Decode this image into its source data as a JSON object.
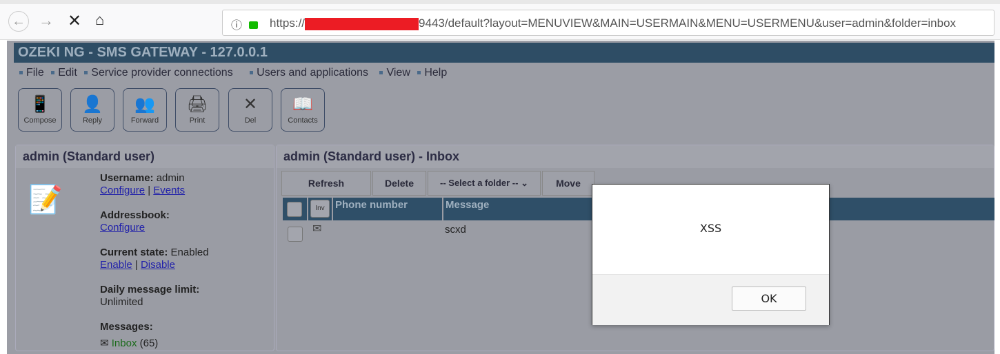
{
  "browser": {
    "url_prefix": "https://",
    "url_suffix": "9443/default?layout=MENUVIEW&MAIN=USERMAIN&MENU=USERMENU&user=admin&folder=inbox"
  },
  "header": {
    "title": "OZEKI NG - SMS GATEWAY - 127.0.0.1"
  },
  "menu": [
    "File",
    "Edit",
    "Service provider connections",
    "Users and applications",
    "View",
    "Help"
  ],
  "toolbar": [
    {
      "label": "Compose",
      "icon": "📱"
    },
    {
      "label": "Reply",
      "icon": "👤"
    },
    {
      "label": "Forward",
      "icon": "👥"
    },
    {
      "label": "Print",
      "icon": "🖨"
    },
    {
      "label": "Del",
      "icon": "✕"
    },
    {
      "label": "Contacts",
      "icon": "📖"
    }
  ],
  "left": {
    "title": "admin (Standard user)",
    "username_label": "Username:",
    "username": "admin",
    "configure": "Configure",
    "events": "Events",
    "addressbook_label": "Addressbook:",
    "state_label": "Current state:",
    "state": "Enabled",
    "enable": "Enable",
    "disable": "Disable",
    "limit_label": "Daily message limit:",
    "limit": "Unlimited",
    "messages_label": "Messages:",
    "inbox": "Inbox",
    "inbox_count": "(65)"
  },
  "right": {
    "title": "admin (Standard user) - Inbox",
    "refresh": "Refresh",
    "delete": "Delete",
    "folder_select": "-- Select a folder --",
    "move": "Move",
    "inv": "Inv",
    "col_phone": "Phone number",
    "col_message": "Message",
    "rows": [
      {
        "phone": "",
        "message": "scxd"
      }
    ]
  },
  "dialog": {
    "message": "XSS",
    "ok": "OK"
  }
}
